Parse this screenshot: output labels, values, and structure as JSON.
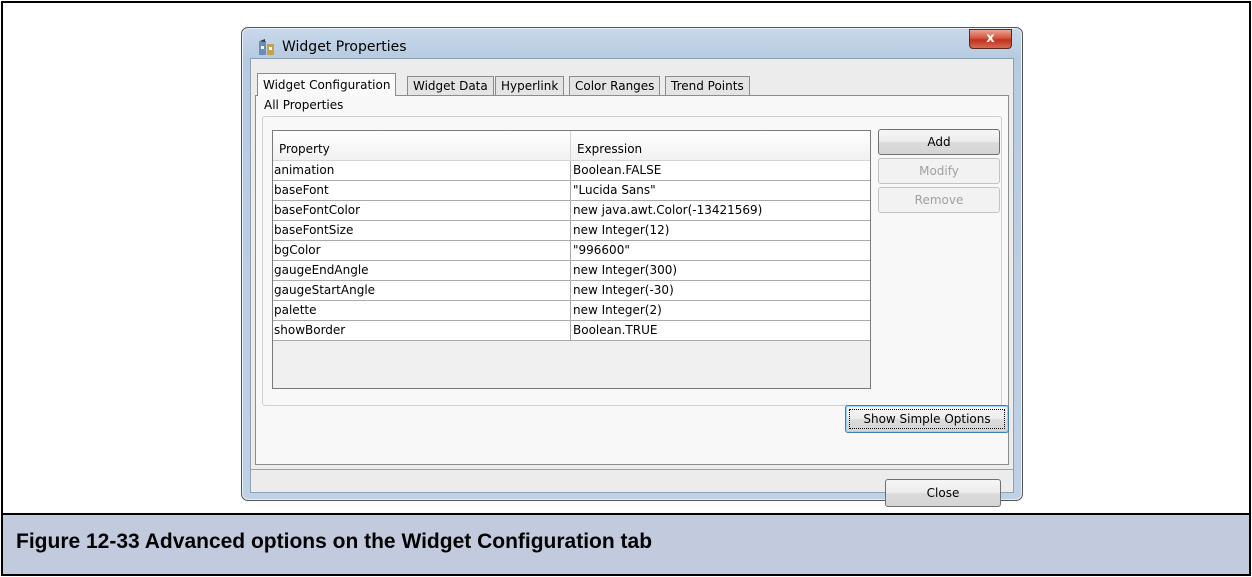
{
  "window": {
    "title": "Widget Properties",
    "close_glyph": "x",
    "icon": "app-icon"
  },
  "tabs": [
    {
      "label": "Widget Configuration",
      "active": true
    },
    {
      "label": "Widget Data",
      "active": false
    },
    {
      "label": "Hyperlink",
      "active": false
    },
    {
      "label": "Color Ranges",
      "active": false
    },
    {
      "label": "Trend Points",
      "active": false
    }
  ],
  "group": {
    "label": "All Properties"
  },
  "table": {
    "columns": [
      "Property",
      "Expression"
    ],
    "rows": [
      [
        "animation",
        "Boolean.FALSE"
      ],
      [
        "baseFont",
        "\"Lucida Sans\""
      ],
      [
        "baseFontColor",
        "new java.awt.Color(-13421569)"
      ],
      [
        "baseFontSize",
        "new Integer(12)"
      ],
      [
        "bgColor",
        "\"996600\""
      ],
      [
        "gaugeEndAngle",
        "new Integer(300)"
      ],
      [
        "gaugeStartAngle",
        "new Integer(-30)"
      ],
      [
        "palette",
        "new Integer(2)"
      ],
      [
        "showBorder",
        "Boolean.TRUE"
      ]
    ]
  },
  "buttons": {
    "add": "Add",
    "modify": "Modify",
    "remove": "Remove",
    "show_simple": "Show Simple Options",
    "close": "Close"
  },
  "caption": "Figure 12-33 Advanced options on the Widget Configuration tab",
  "colors": {
    "caption_bg": "#c2cbdd",
    "close_red": "#c0321e"
  }
}
